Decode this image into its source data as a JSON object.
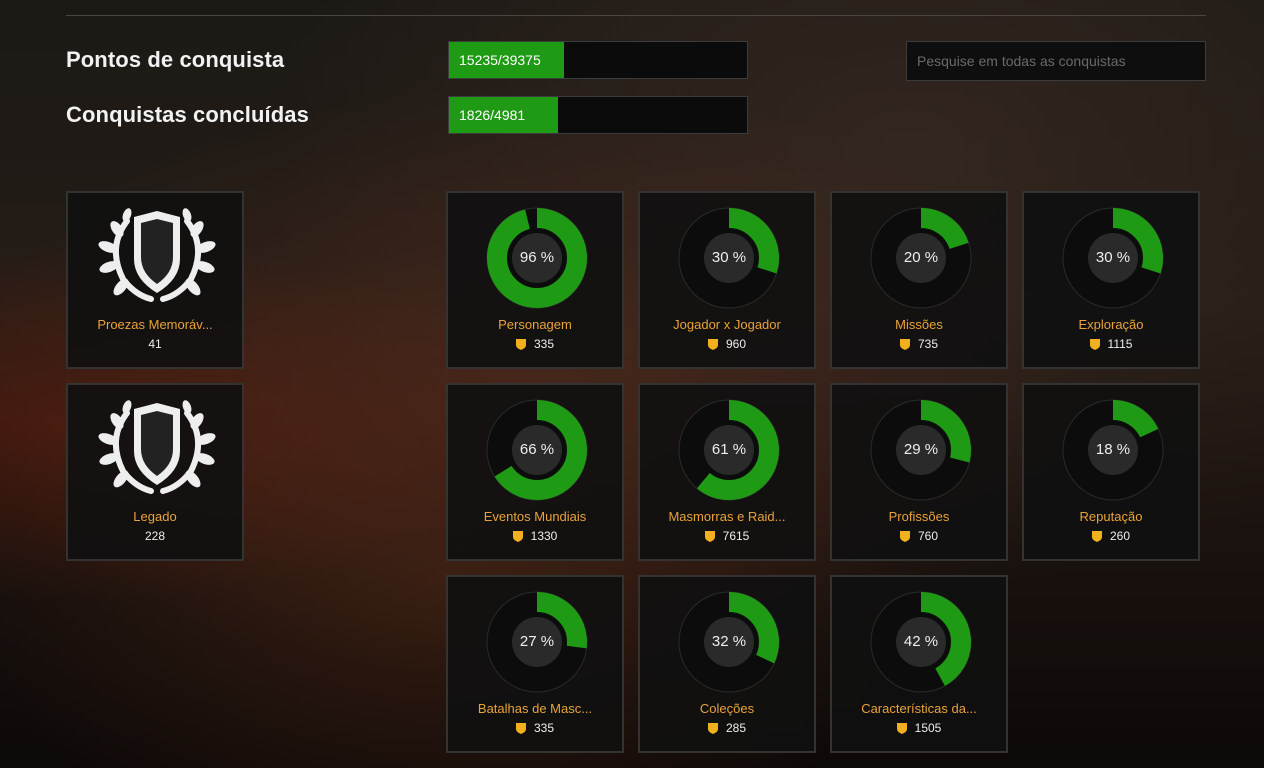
{
  "summary": {
    "points_label": "Pontos de conquista",
    "points_text": "15235/39375",
    "points_fraction": 0.387,
    "completed_label": "Conquistas concluídas",
    "completed_text": "1826/4981",
    "completed_fraction": 0.367
  },
  "search": {
    "placeholder": "Pesquise em todas as conquistas"
  },
  "colors": {
    "accent_green": "#1f9a14",
    "title_orange": "#e9a33a",
    "shield_gold": "#f0b020"
  },
  "special_categories": [
    {
      "title": "Proezas Memoráv...",
      "count": "41",
      "icon": "laurel-shield-icon"
    },
    {
      "title": "Legado",
      "count": "228",
      "icon": "laurel-shield-icon"
    }
  ],
  "categories": [
    {
      "title": "Personagem",
      "count": "335",
      "percent": 96,
      "percent_label": "96 %"
    },
    {
      "title": "Jogador x Jogador",
      "count": "960",
      "percent": 30,
      "percent_label": "30 %"
    },
    {
      "title": "Missões",
      "count": "735",
      "percent": 20,
      "percent_label": "20 %"
    },
    {
      "title": "Exploração",
      "count": "1115",
      "percent": 30,
      "percent_label": "30 %"
    },
    {
      "title": "Eventos Mundiais",
      "count": "1330",
      "percent": 66,
      "percent_label": "66 %"
    },
    {
      "title": "Masmorras e Raid...",
      "count": "7615",
      "percent": 61,
      "percent_label": "61 %"
    },
    {
      "title": "Profissões",
      "count": "760",
      "percent": 29,
      "percent_label": "29 %"
    },
    {
      "title": "Reputação",
      "count": "260",
      "percent": 18,
      "percent_label": "18 %"
    },
    {
      "title": "Batalhas de Masc...",
      "count": "335",
      "percent": 27,
      "percent_label": "27 %"
    },
    {
      "title": "Coleções",
      "count": "285",
      "percent": 32,
      "percent_label": "32 %"
    },
    {
      "title": "Características da...",
      "count": "1505",
      "percent": 42,
      "percent_label": "42 %"
    }
  ]
}
